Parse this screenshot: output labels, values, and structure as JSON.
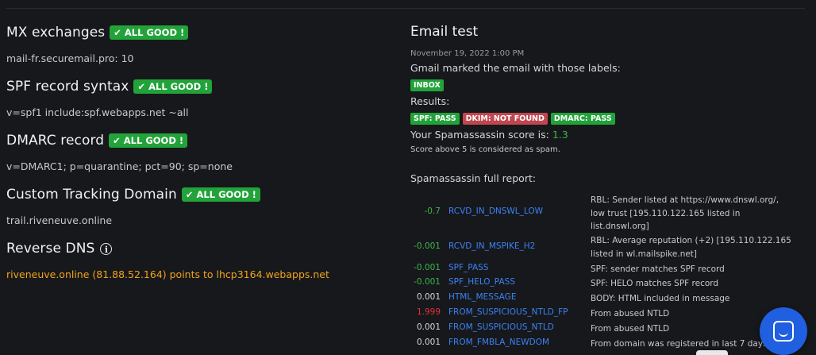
{
  "left": {
    "mx": {
      "title": "MX exchanges",
      "badge": "✔ ALL GOOD !",
      "value": "mail-fr.securemail.pro: 10"
    },
    "spf": {
      "title": "SPF record syntax",
      "badge": "✔ ALL GOOD !",
      "value": "v=spf1 include:spf.webapps.net ~all"
    },
    "dmarc": {
      "title": "DMARC record",
      "badge": "✔ ALL GOOD !",
      "value": "v=DMARC1; p=quarantine; pct=90; sp=none"
    },
    "tracking": {
      "title": "Custom Tracking Domain",
      "badge": "✔ ALL GOOD !",
      "value": "trail.riveneuve.online"
    },
    "rdns": {
      "title": "Reverse DNS",
      "info_icon": "info-icon",
      "value": "riveneuve.online (81.88.52.164) points to lhcp3164.webapps.net"
    }
  },
  "right": {
    "title": "Email test",
    "date": "November 19, 2022 1:00 PM",
    "labels_text": "Gmail marked the email with those labels:",
    "labels": [
      {
        "text": "INBOX",
        "color": "#22a33a"
      }
    ],
    "results_text": "Results:",
    "results": [
      {
        "text": "SPF: PASS",
        "color": "#22a33a"
      },
      {
        "text": "DKIM: NOT FOUND",
        "color": "#c0474f"
      },
      {
        "text": "DMARC: PASS",
        "color": "#22a33a"
      }
    ],
    "score_prefix": "Your Spamassassin score is:",
    "score": "1.3",
    "score_note": "Score above 5 is considered as spam.",
    "report_title": "Spamassassin full report:",
    "report": [
      {
        "score": "-0.7",
        "name": "RCVD_IN_DNSWL_LOW",
        "desc": "RBL: Sender listed at https://www.dnswl.org/, low trust [195.110.122.165 listed in list.dnswl.org]",
        "color": "#3cb44b"
      },
      {
        "score": "-0.001",
        "name": "RCVD_IN_MSPIKE_H2",
        "desc": "RBL: Average reputation (+2) [195.110.122.165 listed in wl.mailspike.net]",
        "color": "#3cb44b"
      },
      {
        "score": "-0.001",
        "name": "SPF_PASS",
        "desc": "SPF: sender matches SPF record",
        "color": "#3cb44b"
      },
      {
        "score": "-0.001",
        "name": "SPF_HELO_PASS",
        "desc": "SPF: HELO matches SPF record",
        "color": "#3cb44b"
      },
      {
        "score": "0.001",
        "name": "HTML_MESSAGE",
        "desc": "BODY: HTML included in message",
        "color": "#d6d6da"
      },
      {
        "score": "1.999",
        "name": "FROM_SUSPICIOUS_NTLD_FP",
        "desc": "From abused NTLD",
        "color": "#e0303a"
      },
      {
        "score": "0.001",
        "name": "FROM_SUSPICIOUS_NTLD",
        "desc": "From abused NTLD",
        "color": "#d6d6da"
      },
      {
        "score": "0.001",
        "name": "FROM_FMBLA_NEWDOM",
        "desc": "From domain was registered in last 7 days",
        "color": "#d6d6da"
      }
    ]
  },
  "chat": {
    "icon": "chat-icon"
  }
}
